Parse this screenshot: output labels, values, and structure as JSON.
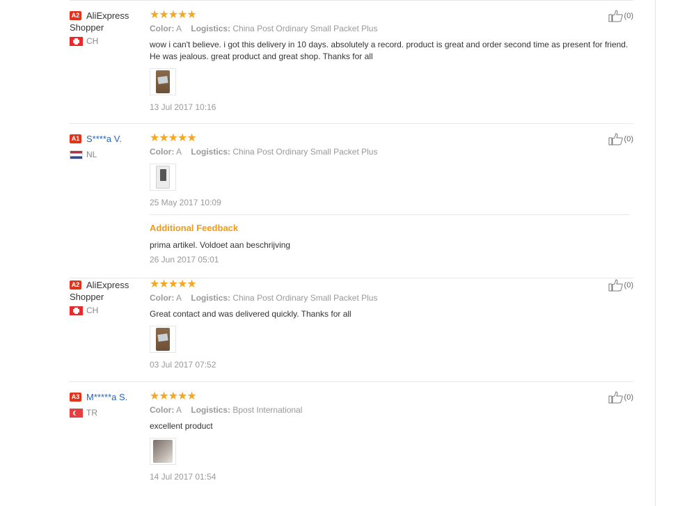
{
  "reviews": [
    {
      "level": "A2",
      "user_line1": "AliExpress",
      "user_line2": "Shopper",
      "country": "CH",
      "stars": "★★★★★",
      "color_label": "Color:",
      "color_value": "A",
      "logistics_label": "Logistics:",
      "logistics_value": "China Post Ordinary Small Packet Plus",
      "text": "wow i can't believe. i got this delivery in 10 days. absolutely a record. product is great and order second time as present for friend. He was jealous. great product and great shop. Thanks for all",
      "date": "13 Jul 2017 10:16",
      "useful": "(0)"
    },
    {
      "level": "A1",
      "user_line1": "S****a V.",
      "country": "NL",
      "stars": "★★★★★",
      "color_label": "Color:",
      "color_value": "A",
      "logistics_label": "Logistics:",
      "logistics_value": "China Post Ordinary Small Packet Plus",
      "date": "25 May 2017 10:09",
      "useful": "(0)",
      "additional_title": "Additional Feedback",
      "additional_text": "prima artikel. Voldoet aan beschrijving",
      "additional_date": "26 Jun 2017 05:01"
    },
    {
      "level": "A2",
      "user_line1": "AliExpress",
      "user_line2": "Shopper",
      "country": "CH",
      "stars": "★★★★★",
      "color_label": "Color:",
      "color_value": "A",
      "logistics_label": "Logistics:",
      "logistics_value": "China Post Ordinary Small Packet Plus",
      "text": "Great contact and was delivered quickly. Thanks for all",
      "date": "03 Jul 2017 07:52",
      "useful": "(0)"
    },
    {
      "level": "A3",
      "user_line1": "M*****a S.",
      "country": "TR",
      "stars": "★★★★★",
      "color_label": "Color:",
      "color_value": "A",
      "logistics_label": "Logistics:",
      "logistics_value": "Bpost International",
      "text": "excellent product",
      "date": "14 Jul 2017 01:54",
      "useful": "(0)"
    }
  ],
  "colors": {
    "stars": "#f5a623",
    "level_badge": "#e0351c",
    "user_link": "#2466b8",
    "additional_feedback": "#f39a19"
  },
  "icons": {
    "like": "thumbs-up-icon",
    "star": "star-icon"
  }
}
